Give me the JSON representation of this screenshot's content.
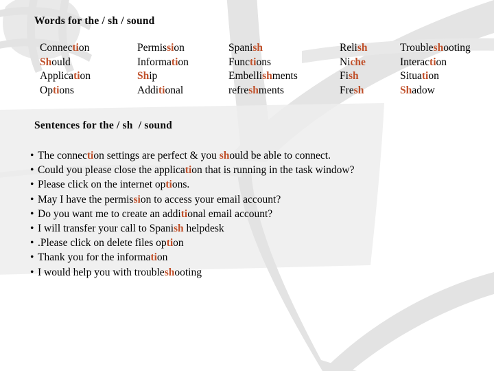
{
  "slide": {
    "background_color": "#ffffff",
    "accent_color": "#C0502A",
    "decor_color": "#e2e2e2",
    "text_color": "#000000"
  },
  "words_section": {
    "heading": "Words for the / sh / sound",
    "columns": [
      {
        "id": "col-1",
        "items": [
          {
            "pre": "Connec",
            "hl": "ti",
            "post": "on"
          },
          {
            "pre": "",
            "hl": "Sh",
            "post": "ould"
          },
          {
            "pre": "Applica",
            "hl": "ti",
            "post": "on"
          },
          {
            "pre": "Op",
            "hl": "ti",
            "post": "ons"
          }
        ]
      },
      {
        "id": "col-2",
        "items": [
          {
            "pre": "Permis",
            "hl": "si",
            "post": "on"
          },
          {
            "pre": "Informa",
            "hl": "ti",
            "post": "on"
          },
          {
            "pre": "",
            "hl": "Sh",
            "post": "ip"
          },
          {
            "pre": "Addi",
            "hl": "ti",
            "post": "onal"
          }
        ]
      },
      {
        "id": "col-3",
        "items": [
          {
            "pre": "Spani",
            "hl": "sh",
            "post": ""
          },
          {
            "pre": "Func",
            "hl": "ti",
            "post": "ons"
          },
          {
            "pre": "Embelli",
            "hl": "sh",
            "post": "ments"
          },
          {
            "pre": "refre",
            "hl": "sh",
            "post": "ments"
          }
        ]
      },
      {
        "id": "col-4",
        "items": [
          {
            "pre": "Reli",
            "hl": "sh",
            "post": ""
          },
          {
            "pre": "Ni",
            "hl": "che",
            "post": ""
          },
          {
            "pre": "Fi",
            "hl": "sh",
            "post": ""
          },
          {
            "pre": "Fre",
            "hl": "sh",
            "post": ""
          }
        ]
      },
      {
        "id": "col-5",
        "items": [
          {
            "pre": "Trouble",
            "hl": "sh",
            "post": "ooting"
          },
          {
            "pre": "Interac",
            "hl": "ti",
            "post": "on"
          },
          {
            "pre": "Situa",
            "hl": "ti",
            "post": "on"
          },
          {
            "pre": "",
            "hl": "Sh",
            "post": "adow"
          }
        ]
      }
    ]
  },
  "sentences_section": {
    "heading": "Sentences for the / sh  / sound",
    "bullet_glyph": "•",
    "items": [
      [
        {
          "t": "The connec",
          "hl": false
        },
        {
          "t": "ti",
          "hl": true
        },
        {
          "t": "on settings are perfect & you ",
          "hl": false
        },
        {
          "t": "sh",
          "hl": true
        },
        {
          "t": "ould be able to connect.",
          "hl": false
        }
      ],
      [
        {
          "t": "Could you please close the applica",
          "hl": false
        },
        {
          "t": "ti",
          "hl": true
        },
        {
          "t": "on that is running in the task window?",
          "hl": false
        }
      ],
      [
        {
          "t": "Please click on the internet op",
          "hl": false
        },
        {
          "t": "ti",
          "hl": true
        },
        {
          "t": "ons.",
          "hl": false
        }
      ],
      [
        {
          "t": "May I have the permis",
          "hl": false
        },
        {
          "t": "si",
          "hl": true
        },
        {
          "t": "on to access your email account?",
          "hl": false
        }
      ],
      [
        {
          "t": "Do you want me to create an addi",
          "hl": false
        },
        {
          "t": "ti",
          "hl": true
        },
        {
          "t": "onal email account?",
          "hl": false
        }
      ],
      [
        {
          "t": "I will transfer your call to Spani",
          "hl": false
        },
        {
          "t": "sh",
          "hl": true
        },
        {
          "t": " helpdesk",
          "hl": false
        }
      ],
      [
        {
          "t": ".Please click on delete files op",
          "hl": false
        },
        {
          "t": "ti",
          "hl": true
        },
        {
          "t": "on",
          "hl": false
        }
      ],
      [
        {
          "t": "Thank you for the informa",
          "hl": false
        },
        {
          "t": "ti",
          "hl": true
        },
        {
          "t": "on",
          "hl": false
        }
      ],
      [
        {
          "t": "I would help you with trouble",
          "hl": false
        },
        {
          "t": "sh",
          "hl": true
        },
        {
          "t": "ooting",
          "hl": false
        }
      ]
    ]
  }
}
